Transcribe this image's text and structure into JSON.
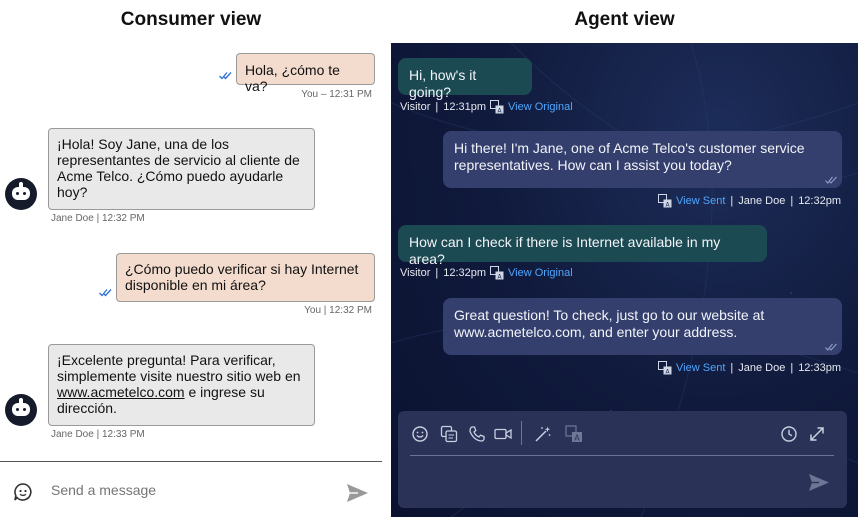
{
  "headings": {
    "consumer": "Consumer view",
    "agent": "Agent view"
  },
  "consumer": {
    "messages": [
      {
        "from": "consumer",
        "text": "Hola, ¿cómo te va?",
        "meta": "You – 12:31 PM"
      },
      {
        "from": "agent",
        "text": "¡Hola! Soy Jane, una de los representantes de servicio al cliente de Acme Telco. ¿Cómo puedo ayudarle hoy?",
        "meta": "Jane Doe | 12:32 PM"
      },
      {
        "from": "consumer",
        "text": "¿Cómo puedo verificar si hay Internet disponible en mi área?",
        "meta": "You | 12:32 PM"
      },
      {
        "from": "agent",
        "text_before": "¡Excelente pregunta! Para verificar, simplemente visite nuestro sitio web en ",
        "link": "www.acmetelco.com",
        "text_after": " e ingrese su dirección.",
        "meta": "Jane Doe | 12:33 PM"
      }
    ],
    "composer": {
      "placeholder": "Send a message"
    }
  },
  "agent": {
    "messages": [
      {
        "from": "visitor",
        "text": "Hi, how's it going?",
        "sender": "Visitor",
        "time": "12:31pm",
        "link": "View Original"
      },
      {
        "from": "agent",
        "text": "Hi there! I'm Jane, one of Acme Telco's customer service representatives. How can I assist you today?",
        "link": "View Sent",
        "sender": "Jane Doe",
        "time": "12:32pm"
      },
      {
        "from": "visitor",
        "text": "How can I check if there is Internet available in my area?",
        "sender": "Visitor",
        "time": "12:32pm",
        "link": "View Original"
      },
      {
        "from": "agent",
        "text": "Great question! To check, just go to our website at www.acmetelco.com, and enter your address.",
        "link": "View Sent",
        "sender": "Jane Doe",
        "time": "12:33pm"
      }
    ],
    "separator": "|",
    "toolbar": [
      "emoji-icon",
      "canned-response-icon",
      "phone-icon",
      "video-icon",
      "ai-assist-icon",
      "translate-icon",
      "history-icon",
      "expand-icon",
      "send-icon"
    ]
  },
  "colors": {
    "consumer_bubble": "#f3dccd",
    "agent_bubble_consumer_side": "#e9e9e9",
    "agent_panel_bg": "#101a3c",
    "visitor_bubble": "#1c4a52",
    "agent_bubble": "#343f6e",
    "link": "#4fa6ff",
    "read_check": "#2f6fd6"
  }
}
